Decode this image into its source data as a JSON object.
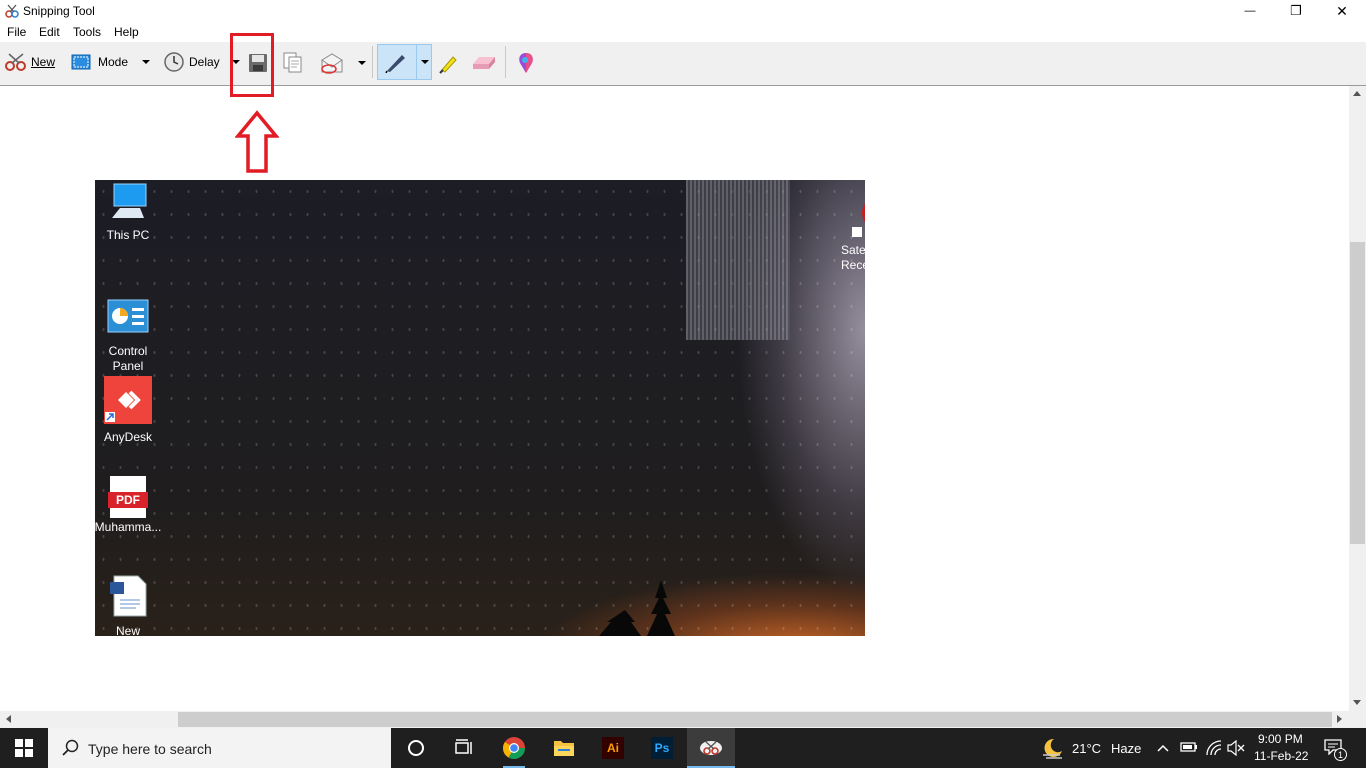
{
  "window": {
    "title": "Snipping Tool",
    "minimize_glyph": "—",
    "maximize_glyph": "❐",
    "close_glyph": "✕"
  },
  "menu": [
    "File",
    "Edit",
    "Tools",
    "Help"
  ],
  "toolbar": {
    "new_label": "New",
    "mode_label": "Mode",
    "delay_label": "Delay",
    "icons": [
      "scissors-icon",
      "mode-icon",
      "clock-icon",
      "save-icon",
      "copy-icon",
      "send-email-icon",
      "pen-icon",
      "highlighter-icon",
      "eraser-icon",
      "paint3d-icon"
    ]
  },
  "snip": {
    "desktop_icons": [
      {
        "label": "This PC"
      },
      {
        "label": "Control\nPanel"
      },
      {
        "label": "AnyDesk"
      },
      {
        "label": "Muhamma..."
      },
      {
        "label": "New"
      },
      {
        "label": "Satel\nRece"
      }
    ],
    "pdf_badge": "PDF"
  },
  "taskbar": {
    "search_placeholder": "Type here to search",
    "adobe_illustrator_label": "Ai",
    "photoshop_label": "Ps",
    "weather_temp": "21°C",
    "weather_desc": "Haze",
    "time": "9:00 PM",
    "date": "11-Feb-22",
    "notification_count": "1"
  },
  "colors": {
    "annotation_red": "#e21c25",
    "toolbar_bg": "#f0f0f0",
    "taskbar_bg": "#1f1f1f"
  }
}
